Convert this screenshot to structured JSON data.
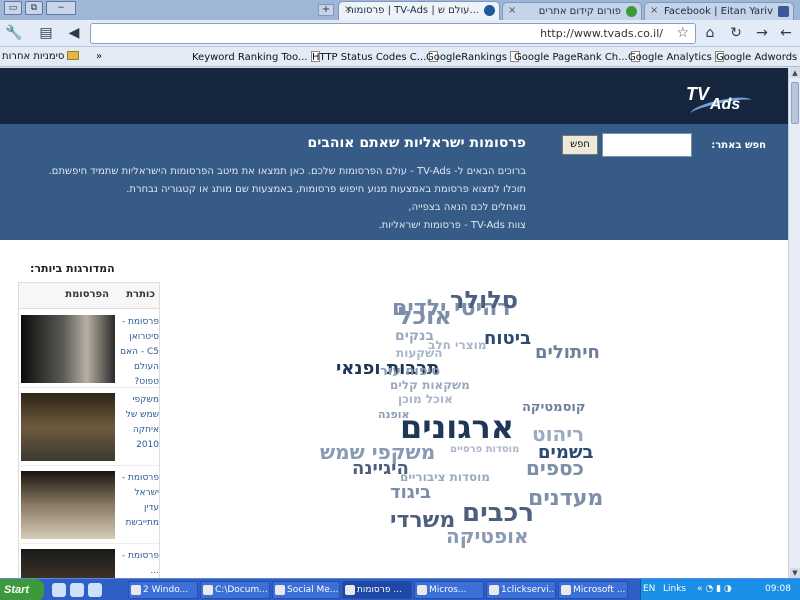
{
  "browser": {
    "tabs": [
      {
        "title": "פרסומות | TV-Ads | עולם ש...",
        "active": true,
        "favicon_color": "#1e5a9c"
      },
      {
        "title": "פורום קידום אתרים",
        "active": false,
        "favicon_color": "#3d9b35"
      },
      {
        "title": "Facebook | Eitan Yariv",
        "active": false,
        "favicon_color": "#3b5998"
      }
    ],
    "new_tab_label": "+",
    "window_buttons": [
      "▭",
      "⧉",
      "−"
    ],
    "address": "http://www.tvads.co.il/",
    "toolbar_icons": {
      "back": "back-arrow-icon",
      "forward": "forward-arrow-icon",
      "reload": "reload-icon",
      "home": "home-icon",
      "star": "star-icon",
      "page_menu": "page-menu-icon",
      "wrench": "wrench-icon"
    },
    "bookmarks": [
      "Google Adwords",
      "Google Analytics",
      "Google PageRank Ch...",
      "GoogleRankings",
      "HTTP Status Codes C...",
      "Keyword Ranking Too..."
    ],
    "other_bookmarks_label": "סימניות אחרות",
    "overflow_label": "»"
  },
  "site": {
    "logo_tv": "TV",
    "logo_ads": "Ads",
    "intro_title": "פרסומות ישראליות שאתם אוהבים",
    "intro_lines": [
      "ברוכים הבאים ל- TV-Ads - עולם הפרסומות שלכם. כאן תמצאו את מיטב הפרסומות הישראליות שתמיד חיפשתם.",
      "תוכלו למצוא פרסומת באמצעות מנוע חיפוש פרסומות, באמצעות שם מותג או קטגוריה נבחרת.",
      "מאחלים לכם הנאה בצפייה,",
      "צוות TV-Ads - פרסומות ישראליות."
    ],
    "search_label": "חפש באתר:",
    "search_value": "",
    "search_button": "חפש",
    "sidebar_title": "המדורגות ביותר:",
    "sidebar_cols": {
      "title": "כותרת",
      "ad": "הפרסומת"
    },
    "top_ads": [
      {
        "lines": [
          "פרסומת -",
          "סיטרואן",
          "C5 - האם",
          "העולם",
          "טפוט?"
        ],
        "thumb_colors": [
          "#0c0c0c",
          "#5b5a55",
          "#b8b0a2"
        ]
      },
      {
        "lines": [
          "משקפי",
          "שמש של",
          "איחקה",
          "2010"
        ],
        "thumb_colors": [
          "#2b2418",
          "#6e5a3c",
          "#3c3a30"
        ]
      },
      {
        "lines": [
          "פרסומת -",
          "ישראל",
          "עדין",
          "מתייבשת"
        ],
        "thumb_colors": [
          "#1a1410",
          "#8a7a66",
          "#d6cbb8"
        ]
      },
      {
        "lines": [
          "פרסומת -",
          "..."
        ],
        "thumb_colors": [
          "#1a1a1a",
          "#4a3a2a",
          "#888"
        ]
      }
    ],
    "tag_cloud": [
      {
        "text": "רהיטי ילדים",
        "size": 22,
        "color": "#7d8ea8"
      },
      {
        "text": "סלולר",
        "size": 24,
        "color": "#4d5f7c"
      },
      {
        "text": "אוכל",
        "size": 24,
        "color": "#7d8ea8"
      },
      {
        "text": "בנקים",
        "size": 14,
        "color": "#9aaac0"
      },
      {
        "text": "ביטוח",
        "size": 18,
        "color": "#2d4a70"
      },
      {
        "text": "חיתולים",
        "size": 18,
        "color": "#6d7f9c"
      },
      {
        "text": "מוצרי חלב",
        "size": 12,
        "color": "#a9b6ca"
      },
      {
        "text": "השקעות",
        "size": 12,
        "color": "#a9b6ca"
      },
      {
        "text": "תרבות ופנאי",
        "size": 18,
        "color": "#1f3656"
      },
      {
        "text": "טיפוח עור",
        "size": 13,
        "color": "#8a9ab2"
      },
      {
        "text": "משקאות קלים",
        "size": 12,
        "color": "#9aaac0"
      },
      {
        "text": "אוכל מוכן",
        "size": 12,
        "color": "#a9b6ca"
      },
      {
        "text": "קוסמטיקה",
        "size": 13,
        "color": "#6d7f9c"
      },
      {
        "text": "אופנה",
        "size": 11,
        "color": "#8a9ab2"
      },
      {
        "text": "ארגונים",
        "size": 32,
        "color": "#1f3656"
      },
      {
        "text": "ריהוט",
        "size": 20,
        "color": "#9aaac0"
      },
      {
        "text": "בשמים",
        "size": 18,
        "color": "#2d4a70"
      },
      {
        "text": "משקפי שמש",
        "size": 20,
        "color": "#8a9ab2"
      },
      {
        "text": "מוסדות פרסיים",
        "size": 10,
        "color": "#a9b6ca"
      },
      {
        "text": "היגיינה",
        "size": 18,
        "color": "#4d5f7c"
      },
      {
        "text": "כספים",
        "size": 20,
        "color": "#7d8ea8"
      },
      {
        "text": "מוסדות ציבוריים",
        "size": 12,
        "color": "#9aaac0"
      },
      {
        "text": "ביגוד",
        "size": 18,
        "color": "#7d8ea8"
      },
      {
        "text": "מעדנים",
        "size": 22,
        "color": "#7d8ea8"
      },
      {
        "text": "רכבים",
        "size": 26,
        "color": "#4d5f7c"
      },
      {
        "text": "משרדי",
        "size": 22,
        "color": "#4d5f7c"
      },
      {
        "text": "אופטיקה",
        "size": 20,
        "color": "#8a9ab2"
      }
    ]
  },
  "taskbar": {
    "start_label": "Start",
    "tasks": [
      {
        "label": "2 Windo...",
        "active": false
      },
      {
        "label": "C:\\Docum...",
        "active": false
      },
      {
        "label": "Social Me...",
        "active": false
      },
      {
        "label": "פרסומות ...",
        "active": true
      },
      {
        "label": "Micros...",
        "active": false
      },
      {
        "label": "1clickservi...",
        "active": false
      },
      {
        "label": "Microsoft ...",
        "active": false
      }
    ],
    "lang": "EN",
    "links_label": "Links",
    "clock": "09:08"
  }
}
